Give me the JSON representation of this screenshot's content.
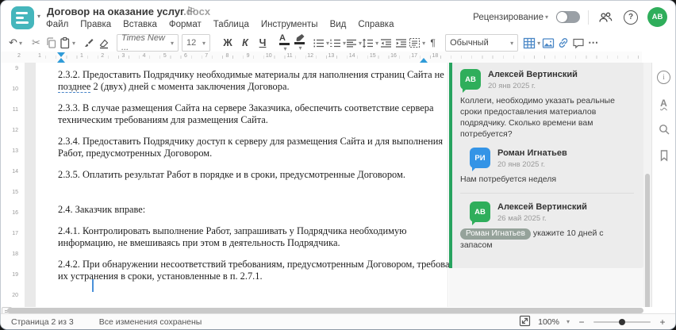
{
  "header": {
    "title": "Договор на оказание услуг",
    "title_ext": ".docx",
    "menu": [
      "Файл",
      "Правка",
      "Вставка",
      "Формат",
      "Таблица",
      "Инструменты",
      "Вид",
      "Справка"
    ],
    "review_label": "Рецензирование",
    "review_toggle_on": false,
    "avatar_initials": "АВ"
  },
  "toolbar": {
    "font_name": "Times New ...",
    "font_size": "12",
    "bold_label": "Ж",
    "italic_label": "К",
    "underline_label": "Ч",
    "font_color_letter": "А",
    "pilcrow": "¶",
    "style_name": "Обычный",
    "more_label": "⋯"
  },
  "icons": {
    "undo": "↶",
    "cut": "✂",
    "flag": "⚐",
    "info": "i",
    "help": "?",
    "spellcheck_letter": "А"
  },
  "ruler": {
    "h_numbers_left": [
      "2",
      "1"
    ],
    "h_numbers": [
      "1",
      "2",
      "3",
      "4",
      "5",
      "6",
      "7",
      "8",
      "9",
      "10",
      "11",
      "12",
      "13",
      "14",
      "15",
      "16",
      "17",
      "18"
    ],
    "v_numbers": [
      "9",
      "10",
      "11",
      "12",
      "13",
      "14",
      "15",
      "16",
      "17",
      "18",
      "19",
      "20"
    ]
  },
  "document": {
    "p232": {
      "line1": "2.3.2. Предоставить Подрядчику необходимые материалы для наполнения страниц Сайта не",
      "underlined": "позднее",
      "line2_rest": " 2 (двух) дней с момента заключения Договора."
    },
    "paragraphs": [
      {
        "lines": [
          "2.3.3. В случае размещения Сайта на сервере Заказчика, обеспечить соответствие сервера",
          "техническим требованиям для размещения Сайта."
        ]
      },
      {
        "lines": [
          "2.3.4. Предоставить Подрядчику доступ к серверу для размещения Сайта и для выполнения",
          "Работ, предусмотренных Договором."
        ]
      },
      {
        "lines": [
          "2.3.5. Оплатить результат Работ в порядке и в сроки, предусмотренные Договором."
        ]
      },
      {
        "lines": [
          "2.4. Заказчик вправе:"
        ],
        "gap_before": true
      },
      {
        "lines": [
          "2.4.1. Контролировать выполнение Работ, запрашивать у Подрядчика необходимую",
          "информацию, не вмешиваясь при этом в деятельность Подрядчика."
        ]
      },
      {
        "lines": [
          "2.4.2. При обнаружении несоответствий требованиям, предусмотренным Договором, требовать",
          "их устранения в сроки, установленные в п. 2.7.1."
        ]
      }
    ]
  },
  "comments": {
    "thread": [
      {
        "initials": "АВ",
        "color": "#2fae5b",
        "name": "Алексей Вертинский",
        "date": "20 янв 2025 г.",
        "text": "Коллеги, необходимо указать реальные сроки предоставления материалов подрядчику. Сколько времени вам потребуется?",
        "reply": false
      },
      {
        "initials": "РИ",
        "color": "#3494e6",
        "name": "Роман Игнатьев",
        "date": "20 янв 2025 г.",
        "text": "Нам потребуется неделя",
        "reply": true
      },
      {
        "initials": "АВ",
        "color": "#2fae5b",
        "name": "Алексей Вертинский",
        "date": "26 май 2025 г.",
        "mention": "Роман Игнатьев",
        "text": "укажите 10 дней с запасом",
        "reply": true,
        "divider_before": true
      }
    ]
  },
  "statusbar": {
    "page_label": "Страница 2 из 3",
    "saved_label": "Все изменения сохранены",
    "zoom_value": "100%"
  },
  "colors": {
    "logo": "#45b6bc",
    "accent_blue_icons": "#4a87c6",
    "thread_border_green": "#27a35f",
    "comment_anchor_green": "#2ca05a",
    "mention_pill": "#95a29a",
    "ruler_marker_blue": "#2f9bd8",
    "highlight_yellow": "#f2c511",
    "avatar_green": "#2fae5b",
    "avatar_blue": "#3494e6"
  }
}
